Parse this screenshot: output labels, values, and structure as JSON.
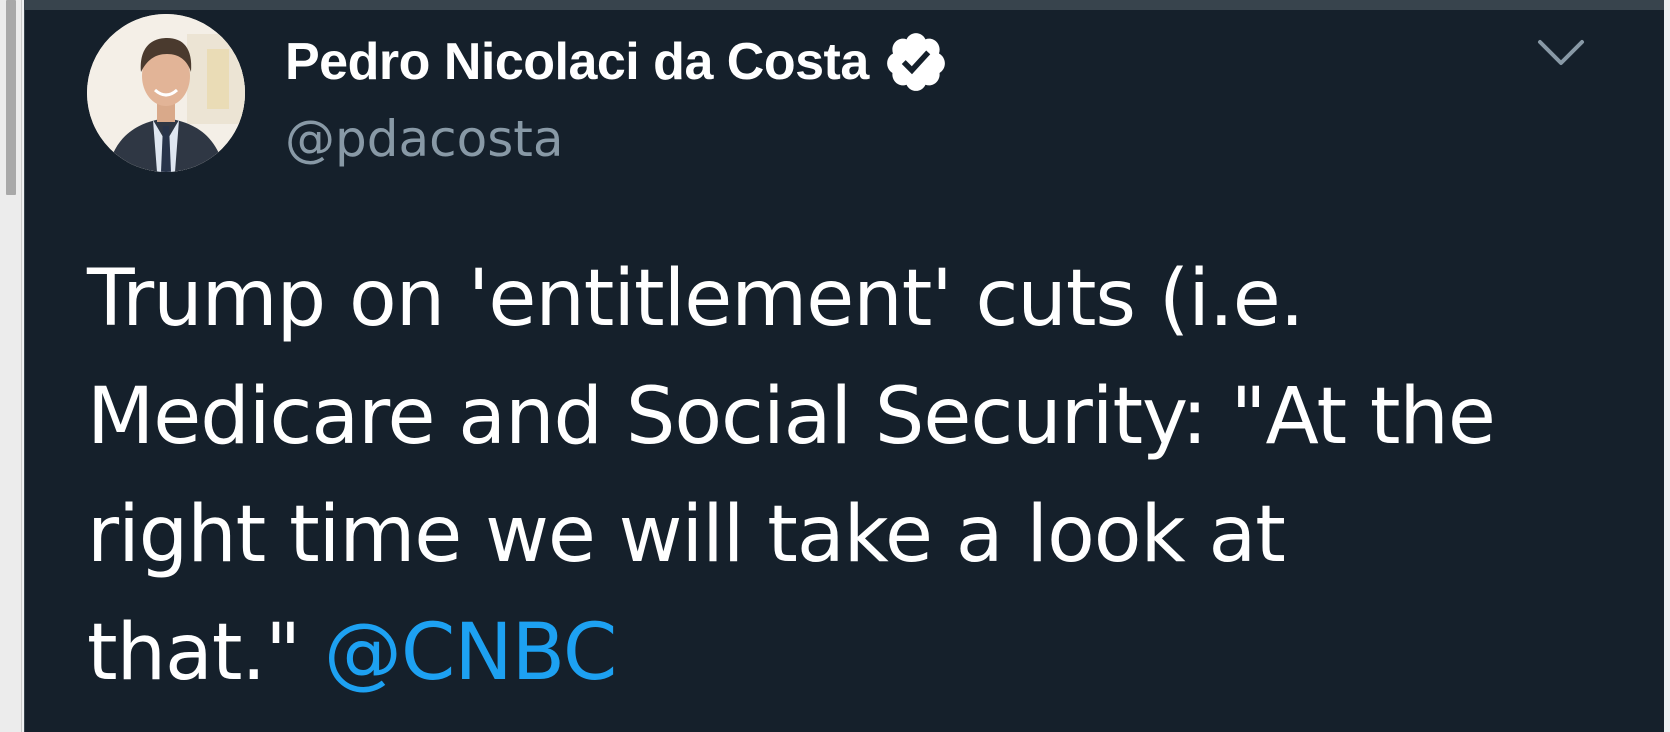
{
  "tweet": {
    "author": {
      "display_name": "Pedro Nicolaci da Costa",
      "handle": "@pdacosta",
      "verified": true,
      "avatar": "profile-photo"
    },
    "text_lines": [
      "Trump on 'entitlement' cuts (i.e.",
      "Medicare and Social Security: \"At the",
      "right time we will take a look at",
      "that.\" "
    ],
    "mention": "@CNBC"
  },
  "icons": {
    "verified": "verified-badge-icon",
    "more": "chevron-down-icon"
  },
  "colors": {
    "background": "#15202b",
    "text": "#ffffff",
    "secondary_text": "#8899a6",
    "link": "#1da1f2",
    "border": "#38444d"
  }
}
